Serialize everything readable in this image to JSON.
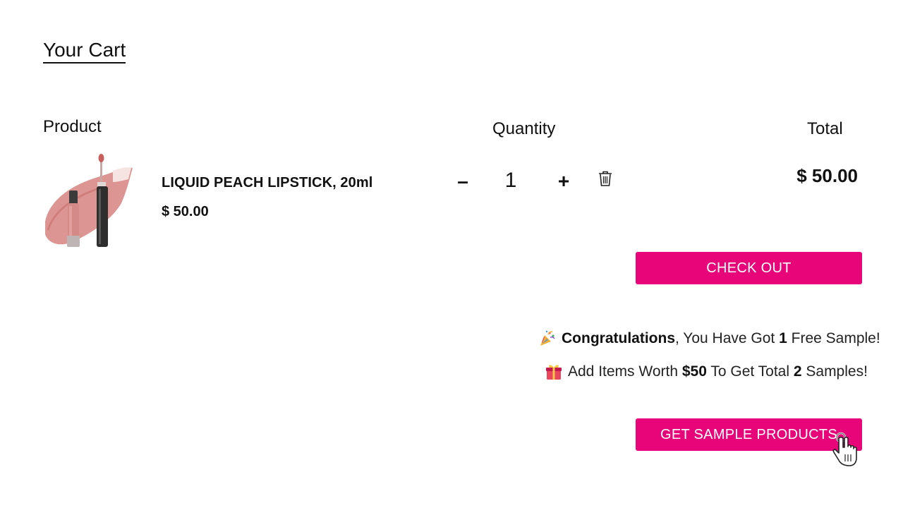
{
  "cart": {
    "title": "Your Cart",
    "columns": {
      "product": "Product",
      "quantity": "Quantity",
      "total": "Total"
    },
    "items": [
      {
        "name": "LIQUID PEACH LIPSTICK, 20ml",
        "price": "$ 50.00",
        "quantity": "1",
        "line_total": "$ 50.00",
        "minus_label": "–",
        "plus_label": "+",
        "image_icon": "lip-gloss-product-image",
        "delete_icon": "trash-icon"
      }
    ],
    "checkout_label": "CHECK OUT"
  },
  "promo": {
    "line1": {
      "icon": "party-popper-icon",
      "strong": "Congratulations",
      "middle": ", You Have Got ",
      "count": "1",
      "end": " Free Sample!"
    },
    "line2": {
      "icon": "gift-icon",
      "start": "Add Items Worth ",
      "amount": "$50",
      "middle": " To Get Total ",
      "count": "2",
      "end": " Samples!"
    },
    "button_label": "GET SAMPLE PRODUCTS"
  },
  "colors": {
    "accent": "#e8057a",
    "text": "#111111"
  }
}
